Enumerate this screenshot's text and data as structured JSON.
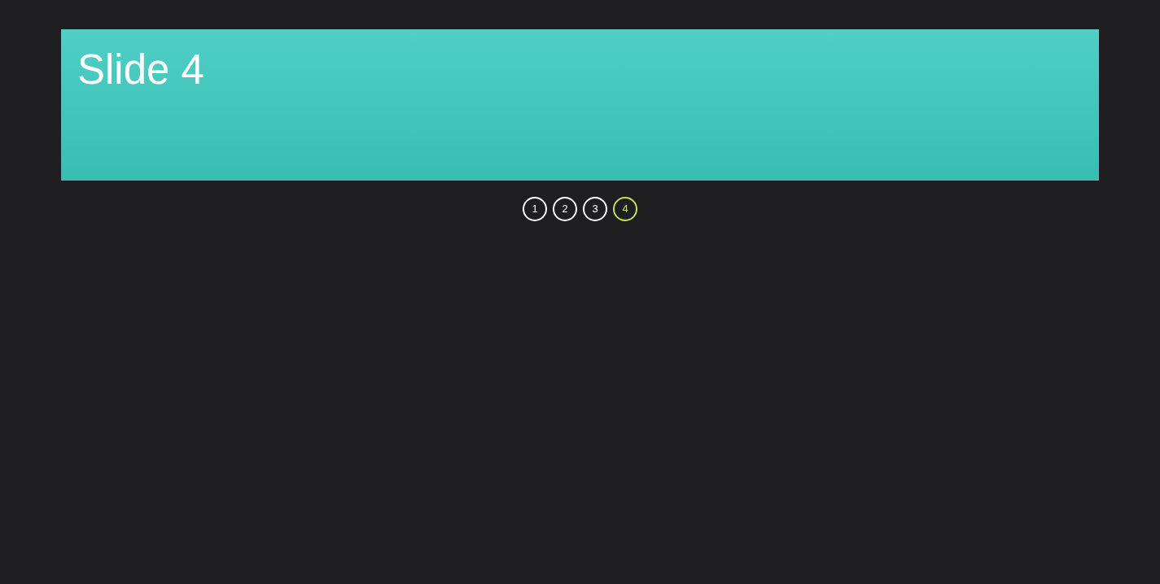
{
  "slide": {
    "title": "Slide 4"
  },
  "pagination": [
    {
      "label": "1",
      "selected": false
    },
    {
      "label": "2",
      "selected": false
    },
    {
      "label": "3",
      "selected": false
    },
    {
      "label": "4",
      "selected": true
    }
  ]
}
